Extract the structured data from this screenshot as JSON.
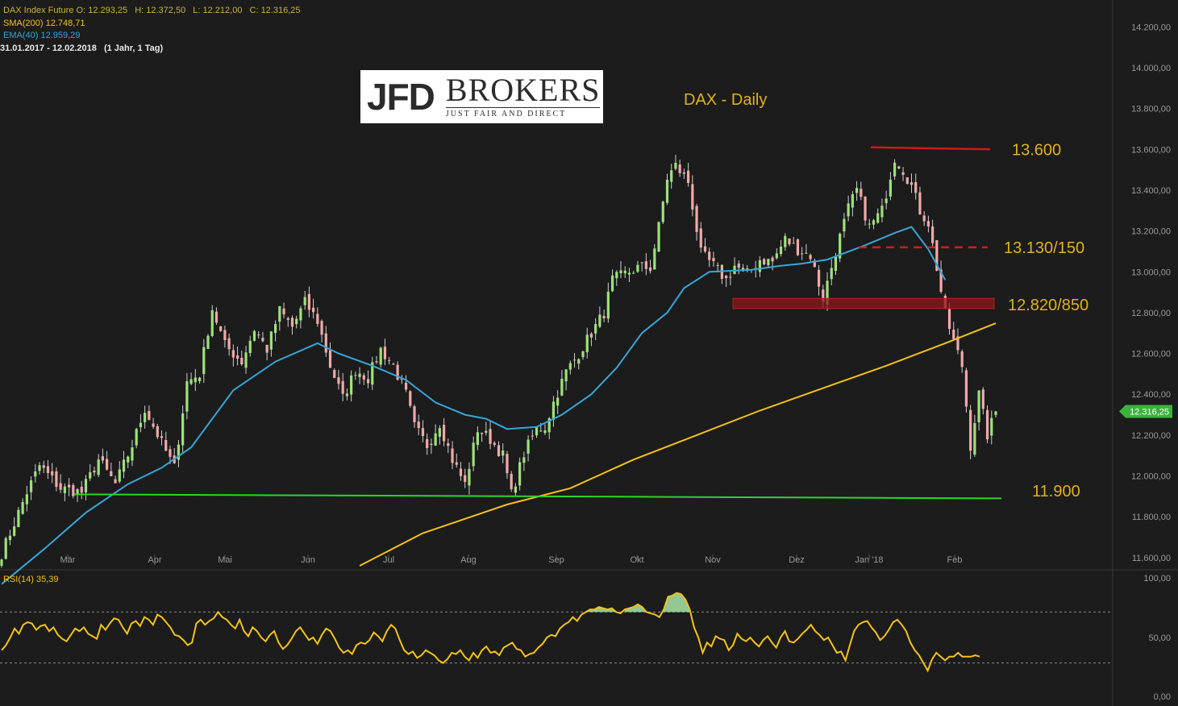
{
  "header": {
    "instrument": "DAX Index Future",
    "open_label": "O:",
    "open": "12.293,25",
    "high_label": "H:",
    "high": "12.372,50",
    "low_label": "L:",
    "low": "12.212,00",
    "close_label": "C:",
    "close": "12.316,25",
    "sma_label": "SMA(200)",
    "sma_value": "12.748,71",
    "ema_label": "EMA(40)",
    "ema_value": "12.959,29",
    "range": "31.01.2017 - 12.02.2018",
    "period": "(1 Jahr, 1 Tag)"
  },
  "logo": {
    "left": "JFD",
    "right": "BROKERS",
    "tagline": "JUST FAIR AND DIRECT"
  },
  "chart_data": [
    {
      "type": "candlestick",
      "title": "DAX - Daily",
      "ylim": [
        11560,
        14300
      ],
      "yticks": [
        11600,
        11800,
        12000,
        12200,
        12400,
        12600,
        12800,
        13000,
        13200,
        13400,
        13600,
        13800,
        14000,
        14200
      ],
      "ytick_labels": [
        "11.600,00",
        "11.800,00",
        "12.000,00",
        "12.200,00",
        "12.400,00",
        "12.600,00",
        "12.800,00",
        "13.000,00",
        "13.200,00",
        "13.400,00",
        "13.600,00",
        "13.800,00",
        "14.000,00",
        "14.200,00"
      ],
      "months": [
        "Mär",
        "Apr",
        "Mai",
        "Jun",
        "Jul",
        "Aug",
        "Sep",
        "Okt",
        "Nov",
        "Dez",
        "Jan '18",
        "Feb"
      ],
      "current_price_label": "12.316,25",
      "current_price": 12316,
      "price_path": [
        [
          0,
          11620
        ],
        [
          6,
          11920
        ],
        [
          9,
          12050
        ],
        [
          14,
          11940
        ],
        [
          19,
          11920
        ],
        [
          23,
          12080
        ],
        [
          27,
          11960
        ],
        [
          31,
          12150
        ],
        [
          34,
          12330
        ],
        [
          38,
          12160
        ],
        [
          41,
          12040
        ],
        [
          44,
          12460
        ],
        [
          47,
          12500
        ],
        [
          50,
          12820
        ],
        [
          53,
          12640
        ],
        [
          57,
          12560
        ],
        [
          60,
          12720
        ],
        [
          63,
          12620
        ],
        [
          66,
          12810
        ],
        [
          69,
          12730
        ],
        [
          72,
          12850
        ],
        [
          75,
          12760
        ],
        [
          78,
          12540
        ],
        [
          81,
          12380
        ],
        [
          84,
          12520
        ],
        [
          87,
          12480
        ],
        [
          90,
          12620
        ],
        [
          93,
          12540
        ],
        [
          96,
          12400
        ],
        [
          98,
          12240
        ],
        [
          101,
          12150
        ],
        [
          104,
          12260
        ],
        [
          107,
          12080
        ],
        [
          110,
          11960
        ],
        [
          113,
          12230
        ],
        [
          116,
          12180
        ],
        [
          119,
          12100
        ],
        [
          121,
          11910
        ],
        [
          124,
          12110
        ],
        [
          127,
          12230
        ],
        [
          129,
          12240
        ],
        [
          131,
          12360
        ],
        [
          134,
          12510
        ],
        [
          137,
          12600
        ],
        [
          140,
          12700
        ],
        [
          143,
          12800
        ],
        [
          145,
          12960
        ],
        [
          148,
          12990
        ],
        [
          151,
          13020
        ],
        [
          154,
          13020
        ],
        [
          156,
          13220
        ],
        [
          158,
          13460
        ],
        [
          160,
          13520
        ],
        [
          163,
          13440
        ],
        [
          166,
          13090
        ],
        [
          169,
          13030
        ],
        [
          172,
          12960
        ],
        [
          174,
          13030
        ],
        [
          177,
          12990
        ],
        [
          180,
          13060
        ],
        [
          183,
          13050
        ],
        [
          186,
          13160
        ],
        [
          189,
          13110
        ],
        [
          192,
          13080
        ],
        [
          195,
          12870
        ],
        [
          198,
          13100
        ],
        [
          201,
          13310
        ],
        [
          203,
          13400
        ],
        [
          206,
          13220
        ],
        [
          209,
          13300
        ],
        [
          212,
          13560
        ],
        [
          214,
          13500
        ],
        [
          216,
          13420
        ],
        [
          218,
          13300
        ],
        [
          220,
          13240
        ],
        [
          222,
          13020
        ],
        [
          224,
          12790
        ],
        [
          226,
          12660
        ],
        [
          228,
          12540
        ],
        [
          230,
          12150
        ],
        [
          232,
          12400
        ],
        [
          234,
          12200
        ],
        [
          236,
          12316
        ]
      ],
      "n_days": 237,
      "series": [
        {
          "name": "SMA(200)",
          "color": "#f4c21a",
          "points": [
            [
              85,
              11560
            ],
            [
              100,
              11720
            ],
            [
              120,
              11860
            ],
            [
              135,
              11940
            ],
            [
              150,
              12080
            ],
            [
              165,
              12200
            ],
            [
              180,
              12320
            ],
            [
              195,
              12430
            ],
            [
              210,
              12540
            ],
            [
              224,
              12650
            ],
            [
              236,
              12748
            ]
          ]
        },
        {
          "name": "EMA(40)",
          "color": "#38a6d8",
          "points": [
            [
              0,
              11470
            ],
            [
              10,
              11640
            ],
            [
              20,
              11820
            ],
            [
              30,
              11960
            ],
            [
              38,
              12040
            ],
            [
              45,
              12140
            ],
            [
              55,
              12420
            ],
            [
              65,
              12560
            ],
            [
              75,
              12650
            ],
            [
              80,
              12600
            ],
            [
              88,
              12540
            ],
            [
              96,
              12470
            ],
            [
              103,
              12360
            ],
            [
              110,
              12300
            ],
            [
              115,
              12280
            ],
            [
              120,
              12230
            ],
            [
              127,
              12240
            ],
            [
              133,
              12300
            ],
            [
              140,
              12400
            ],
            [
              146,
              12530
            ],
            [
              152,
              12700
            ],
            [
              158,
              12800
            ],
            [
              162,
              12920
            ],
            [
              168,
              13000
            ],
            [
              178,
              13010
            ],
            [
              185,
              13030
            ],
            [
              190,
              13040
            ],
            [
              196,
              13060
            ],
            [
              205,
              13130
            ],
            [
              212,
              13190
            ],
            [
              216,
              13220
            ],
            [
              220,
              13110
            ],
            [
              224,
              12960
            ]
          ]
        }
      ],
      "levels": [
        {
          "label": "13.600",
          "value": 13600,
          "color": "#d21818",
          "style": "solid"
        },
        {
          "label": "13.130/150",
          "value": 13120,
          "color": "#e01818",
          "style": "dashed"
        },
        {
          "label": "12.820/850",
          "value_low": 12820,
          "value_high": 12850,
          "color": "#8b1a1a",
          "style": "band"
        },
        {
          "label": "11.900",
          "value": 11900,
          "color": "#2bd62b",
          "style": "solid"
        }
      ]
    },
    {
      "type": "line",
      "title": "RSI(14)",
      "ylabel_value": "35,39",
      "ylim": [
        0,
        100
      ],
      "yticks": [
        0,
        50,
        100
      ],
      "ytick_labels": [
        "0,00",
        "50,00",
        "100,00"
      ],
      "reference_lines": [
        70,
        30
      ],
      "values": [
        40,
        44,
        50,
        57,
        53,
        60,
        62,
        61,
        56,
        59,
        60,
        55,
        58,
        52,
        49,
        47,
        52,
        57,
        55,
        58,
        53,
        51,
        49,
        60,
        56,
        61,
        65,
        64,
        58,
        53,
        61,
        63,
        59,
        66,
        64,
        60,
        68,
        66,
        62,
        58,
        52,
        51,
        48,
        44,
        46,
        61,
        64,
        60,
        63,
        65,
        70,
        66,
        64,
        60,
        57,
        64,
        55,
        51,
        58,
        55,
        50,
        47,
        52,
        55,
        46,
        41,
        44,
        49,
        55,
        58,
        53,
        48,
        50,
        45,
        52,
        57,
        55,
        49,
        42,
        38,
        40,
        37,
        44,
        46,
        45,
        48,
        54,
        51,
        47,
        55,
        60,
        57,
        48,
        40,
        37,
        39,
        34,
        36,
        40,
        38,
        36,
        32,
        30,
        33,
        38,
        37,
        40,
        35,
        32,
        38,
        34,
        40,
        43,
        38,
        39,
        36,
        42,
        44,
        46,
        41,
        40,
        35,
        37,
        38,
        42,
        45,
        50,
        52,
        51,
        57,
        60,
        62,
        66,
        63,
        68,
        70,
        72,
        72,
        74,
        73,
        72,
        73,
        70,
        69,
        72,
        73,
        74,
        76,
        74,
        70,
        69,
        68,
        66,
        72,
        82,
        83,
        85,
        84,
        80,
        72,
        58,
        50,
        38,
        46,
        43,
        51,
        49,
        48,
        40,
        44,
        53,
        49,
        47,
        50,
        46,
        43,
        48,
        51,
        46,
        42,
        50,
        55,
        47,
        46,
        49,
        53,
        56,
        60,
        55,
        52,
        48,
        50,
        44,
        38,
        39,
        32,
        44,
        55,
        60,
        62,
        63,
        58,
        54,
        48,
        51,
        56,
        62,
        64,
        60,
        55,
        46,
        40,
        36,
        30,
        24,
        33,
        38,
        35,
        32,
        35,
        35,
        38,
        35,
        35,
        35,
        36,
        35
      ]
    }
  ]
}
